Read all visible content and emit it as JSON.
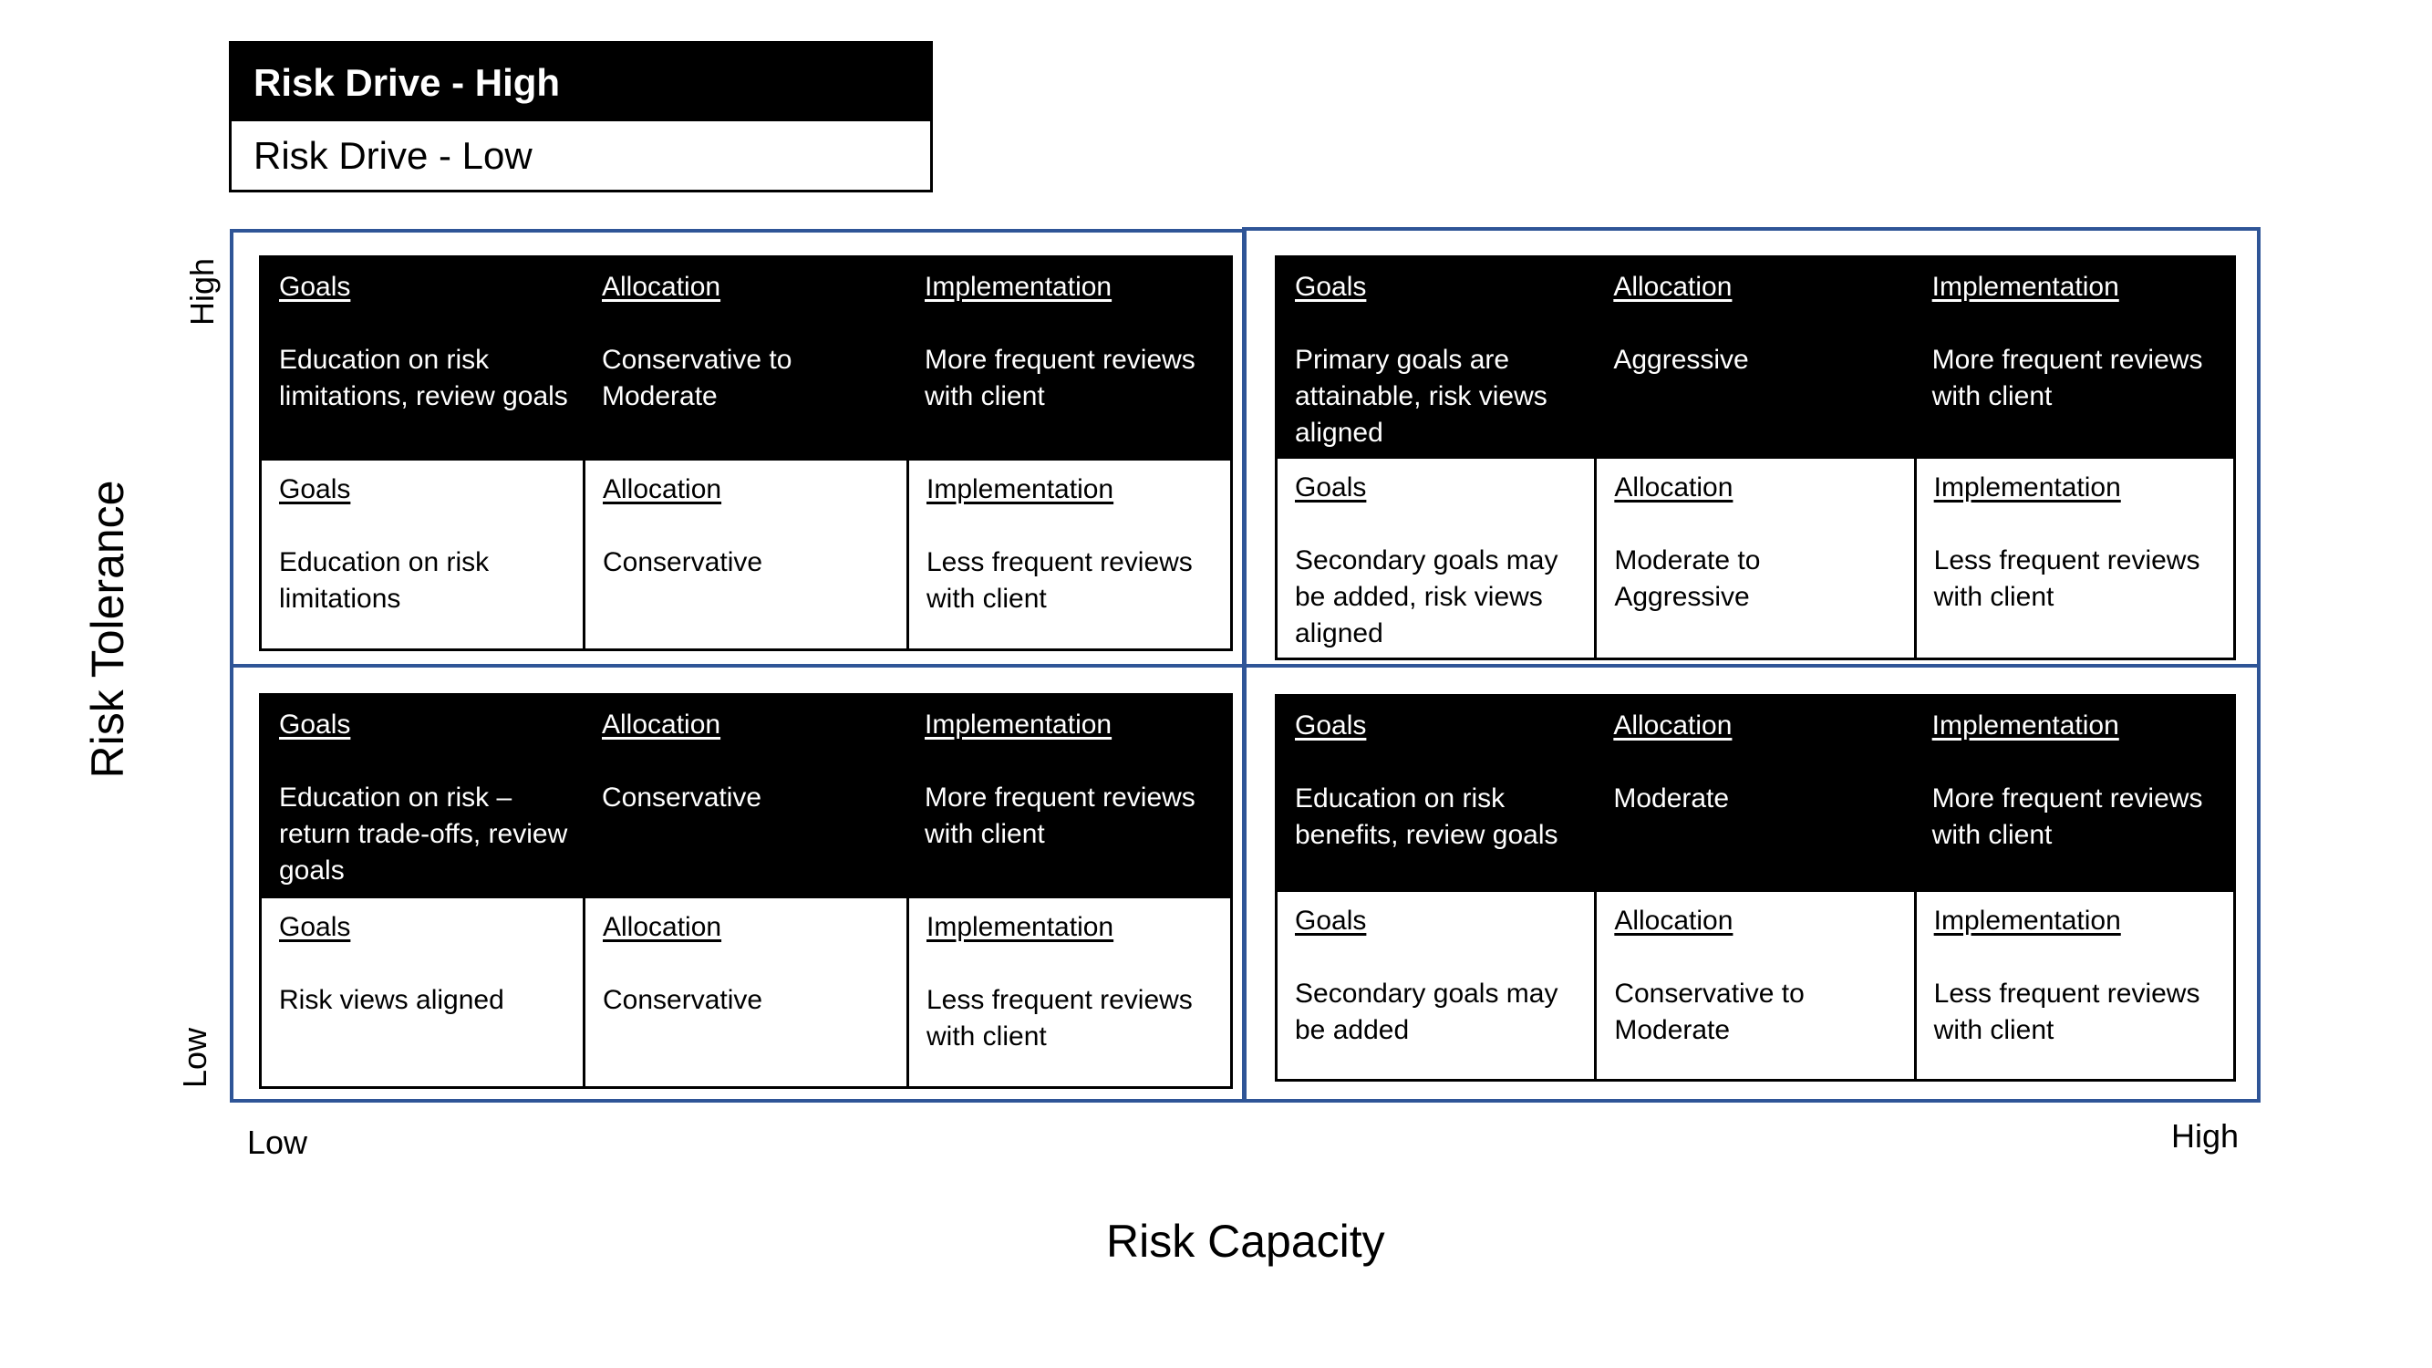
{
  "legend": {
    "high_label": "Risk Drive - High",
    "low_label": "Risk Drive - Low"
  },
  "axes": {
    "y_title": "Risk Tolerance",
    "y_high": "High",
    "y_low": "Low",
    "x_title": "Risk Capacity",
    "x_low": "Low",
    "x_high": "High"
  },
  "colors": {
    "quadrant_border": "#2F5597",
    "high_band": "#000000",
    "low_band": "#FFFFFF"
  },
  "quadrants": {
    "top_left": {
      "risk_tolerance": "High",
      "risk_capacity": "Low",
      "high": [
        {
          "header": "Goals",
          "text": "Education on risk limitations, review goals"
        },
        {
          "header": "Allocation",
          "text": "Conservative to Moderate"
        },
        {
          "header": "Implementation",
          "text": "More frequent reviews with client"
        }
      ],
      "low": [
        {
          "header": "Goals",
          "text": "Education on risk limitations"
        },
        {
          "header": "Allocation",
          "text": "Conservative"
        },
        {
          "header": "Implementation",
          "text": "Less frequent reviews with client"
        }
      ]
    },
    "top_right": {
      "risk_tolerance": "High",
      "risk_capacity": "High",
      "high": [
        {
          "header": "Goals",
          "text": "Primary goals are attainable, risk views aligned"
        },
        {
          "header": "Allocation",
          "text": "Aggressive"
        },
        {
          "header": "Implementation",
          "text": "More frequent reviews with client"
        }
      ],
      "low": [
        {
          "header": "Goals",
          "text": "Secondary goals may be added, risk views aligned"
        },
        {
          "header": "Allocation",
          "text": "Moderate to Aggressive"
        },
        {
          "header": "Implementation",
          "text": "Less frequent reviews with client"
        }
      ]
    },
    "bottom_left": {
      "risk_tolerance": "Low",
      "risk_capacity": "Low",
      "high": [
        {
          "header": "Goals",
          "text": "Education on risk – return trade-offs, review goals"
        },
        {
          "header": "Allocation",
          "text": "Conservative"
        },
        {
          "header": "Implementation",
          "text": "More frequent reviews with client"
        }
      ],
      "low": [
        {
          "header": "Goals",
          "text": "Risk views aligned"
        },
        {
          "header": "Allocation",
          "text": "Conservative"
        },
        {
          "header": "Implementation",
          "text": "Less frequent reviews with client"
        }
      ]
    },
    "bottom_right": {
      "risk_tolerance": "Low",
      "risk_capacity": "High",
      "high": [
        {
          "header": "Goals",
          "text": "Education on risk benefits, review goals"
        },
        {
          "header": "Allocation",
          "text": "Moderate"
        },
        {
          "header": "Implementation",
          "text": "More frequent reviews with client"
        }
      ],
      "low": [
        {
          "header": "Goals",
          "text": "Secondary goals may be added"
        },
        {
          "header": "Allocation",
          "text": "Conservative to Moderate"
        },
        {
          "header": "Implementation",
          "text": "Less frequent reviews with client"
        }
      ]
    }
  }
}
